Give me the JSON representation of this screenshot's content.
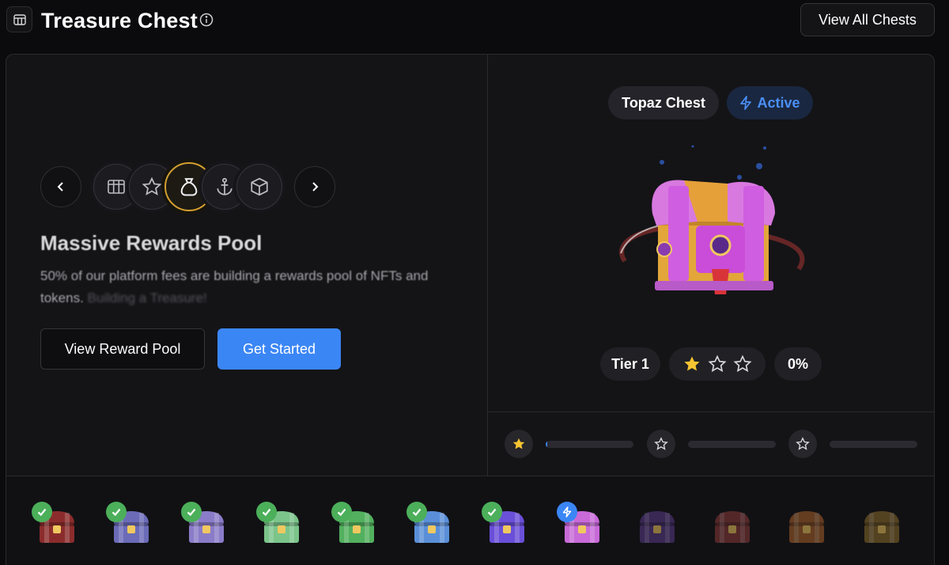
{
  "header": {
    "title": "Treasure Chest",
    "view_all_label": "View All Chests",
    "icons": {
      "app": "grid-icon",
      "info": "info-icon"
    }
  },
  "carousel": {
    "prev_icon": "chevron-left-icon",
    "next_icon": "chevron-right-icon",
    "items": [
      {
        "icon": "grid-icon",
        "active": false
      },
      {
        "icon": "star-icon",
        "active": false
      },
      {
        "icon": "money-bag-icon",
        "active": true
      },
      {
        "icon": "anchor-icon",
        "active": false
      },
      {
        "icon": "box-icon",
        "active": false
      }
    ]
  },
  "feature": {
    "heading": "Massive Rewards Pool",
    "description": "50% of our platform fees are building a rewards pool of NFTs and tokens.",
    "description_faded": "Building a Treasure!"
  },
  "actions": {
    "view_pool_label": "View Reward Pool",
    "get_started_label": "Get Started"
  },
  "chest": {
    "name": "Topaz Chest",
    "status": "Active",
    "tier": "Tier 1",
    "stars_filled": 1,
    "stars_total": 3,
    "progress_label": "0%"
  },
  "progress_steps": [
    {
      "star_filled": true,
      "progress": 0.02
    },
    {
      "star_filled": false,
      "progress": 0
    },
    {
      "star_filled": false,
      "progress": 0
    }
  ],
  "collection": [
    {
      "status": "completed",
      "color": "#8b2c2c"
    },
    {
      "status": "completed",
      "color": "#6b6bb8"
    },
    {
      "status": "completed",
      "color": "#8a7cc8"
    },
    {
      "status": "completed",
      "color": "#7bc48a"
    },
    {
      "status": "completed",
      "color": "#52b05e"
    },
    {
      "status": "completed",
      "color": "#5a8fd8"
    },
    {
      "status": "completed",
      "color": "#6a4fd8"
    },
    {
      "status": "active",
      "color": "#c86ad8"
    },
    {
      "status": "locked",
      "color": "#5a3a8a"
    },
    {
      "status": "locked",
      "color": "#8a3a3a"
    },
    {
      "status": "locked",
      "color": "#a8602a"
    },
    {
      "status": "locked",
      "color": "#8a6a2a"
    }
  ],
  "colors": {
    "accent": "#3b86f5",
    "gold": "#f5c431",
    "success": "#4caf5a"
  }
}
